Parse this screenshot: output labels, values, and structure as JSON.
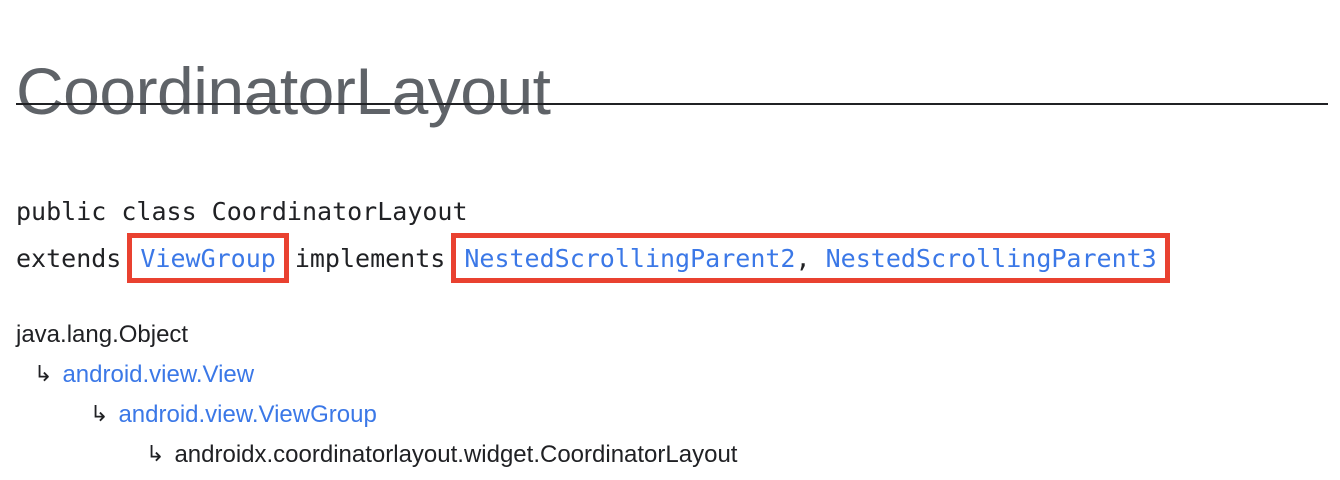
{
  "page": {
    "title": "CoordinatorLayout"
  },
  "declaration": {
    "line1": "public class CoordinatorLayout",
    "extends_keyword": "extends",
    "superclass": "ViewGroup",
    "implements_keyword": "implements",
    "interfaces": [
      "NestedScrollingParent2",
      "NestedScrollingParent3"
    ],
    "separator": ","
  },
  "hierarchy": {
    "arrow_glyph": "↳",
    "items": [
      {
        "label": "java.lang.Object",
        "is_link": false
      },
      {
        "label": "android.view.View",
        "is_link": true
      },
      {
        "label": "android.view.ViewGroup",
        "is_link": true
      },
      {
        "label": "androidx.coordinatorlayout.widget.CoordinatorLayout",
        "is_link": false
      }
    ]
  },
  "colors": {
    "link": "#3b78e7",
    "highlight_border": "#e94130",
    "title": "#5f6368",
    "text": "#202124"
  }
}
